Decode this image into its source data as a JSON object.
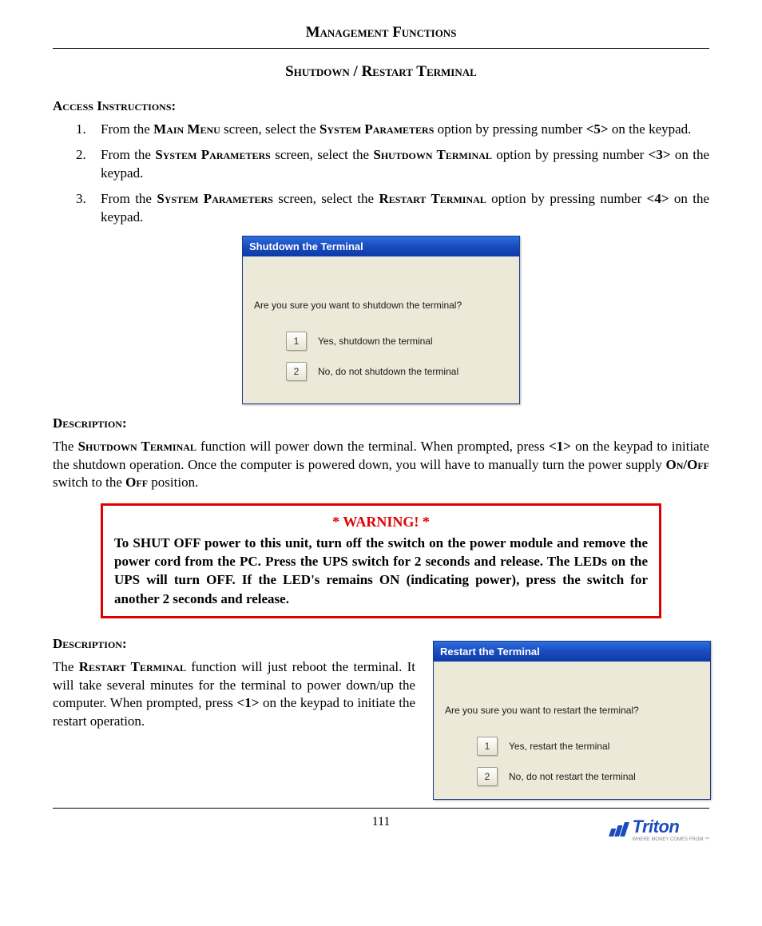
{
  "header": "Management Functions",
  "subtitle": "Shutdown / Restart Terminal",
  "access_label": "Access Instructions:",
  "steps": {
    "s1": {
      "pre": "From the ",
      "sc1": "Main Menu",
      "mid1": " screen, select the ",
      "sc2": "System Parameters",
      "mid2": " option by pressing number ",
      "key": "<5>",
      "post": " on the keypad."
    },
    "s2": {
      "pre": "From the ",
      "sc1": "System Parameters",
      "mid1": " screen, select the ",
      "sc2": "Shutdown  Terminal",
      "mid2": " option by pressing number ",
      "key": "<3>",
      "post": " on the keypad."
    },
    "s3": {
      "pre": "From the ",
      "sc1": "System Parameters",
      "mid1": " screen, select the ",
      "sc2": "Restart Terminal",
      "mid2": "  option by pressing number ",
      "key": "<4>",
      "post": " on the keypad."
    }
  },
  "dialog_shutdown": {
    "title": "Shutdown the Terminal",
    "question": "Are you sure you want to shutdown the terminal?",
    "opt1_key": "1",
    "opt1_label": "Yes, shutdown the terminal",
    "opt2_key": "2",
    "opt2_label": "No, do not shutdown the terminal"
  },
  "desc_label": "Description:",
  "desc1": {
    "pre": "The ",
    "sc1": "Shutdown Terminal",
    "mid1": " function will power down the terminal. When prompted, press ",
    "key": "<1>",
    "mid2": " on the keypad to initiate the shutdown operation. Once the computer is powered down, you will have to manually turn the power supply  ",
    "sc2": "On/Off",
    "mid3": " switch to the ",
    "sc3": "Off",
    "post": " position."
  },
  "warning": {
    "title": "* WARNING! *",
    "body": "To SHUT OFF power to this unit, turn off the switch on the power module and remove the power cord from the PC.  Press the UPS switch for 2 seconds and release.  The LEDs on the UPS will turn OFF.  If the LED's remains ON (indicating power), press the switch for another 2 seconds and release."
  },
  "desc2": {
    "pre": "The ",
    "sc1": "Restart Terminal",
    "mid1": " function will just reboot the terminal. It will take several minutes for the terminal to power down/up the computer. When prompted, press ",
    "key": "<1>",
    "post": " on the keypad to initiate the restart operation."
  },
  "dialog_restart": {
    "title": "Restart the Terminal",
    "question": "Are you sure you want to restart the terminal?",
    "opt1_key": "1",
    "opt1_label": "Yes, restart the terminal",
    "opt2_key": "2",
    "opt2_label": "No, do not restart the terminal"
  },
  "page_number": "111",
  "logo": {
    "brand": "Triton",
    "tagline": "WHERE MONEY COMES FROM.™"
  }
}
